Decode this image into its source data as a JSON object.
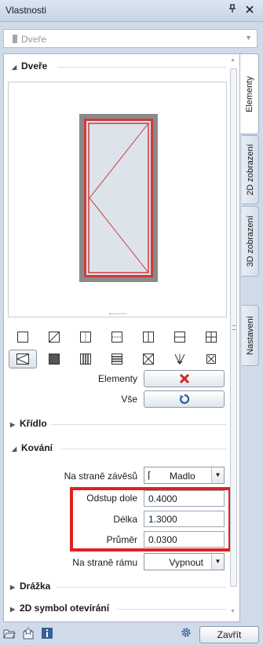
{
  "window": {
    "title": "Vlastnosti",
    "pin_icon": "pin-icon",
    "close_icon": "close-icon"
  },
  "element_selector": {
    "value": "Dveře"
  },
  "sections": {
    "dvere": {
      "label": "Dveře",
      "expanded": true
    },
    "kridlo": {
      "label": "Křídlo",
      "expanded": false
    },
    "kovani": {
      "label": "Kování",
      "expanded": true
    },
    "drazka": {
      "label": "Drážka",
      "expanded": false
    },
    "symbol2d": {
      "label": "2D symbol otevírání",
      "expanded": false
    }
  },
  "element_icons": [
    "frame-icon",
    "diagonal-frame-icon",
    "left-divider-icon",
    "top-divider-icon",
    "vertical-split-icon",
    "horizontal-split-icon",
    "cross-split-icon",
    "swing-left-icon",
    "solid-panel-icon",
    "vertical-bars-icon",
    "horizontal-bars-icon",
    "x-cross-icon",
    "arrow-down-cross-icon",
    "small-x-icon"
  ],
  "selected_icon": "swing-left-icon",
  "actions": {
    "elementy_label": "Elementy",
    "vse_label": "Vše",
    "delete_icon": "red-x-icon",
    "reset_icon": "refresh-icon"
  },
  "hardware": {
    "hinge_side_label": "Na straně závěsů",
    "hinge_side_value": "Madlo",
    "offset_label": "Odstup dole",
    "offset_value": "0.4000",
    "length_label": "Délka",
    "length_value": "1.3000",
    "diameter_label": "Průměr",
    "diameter_value": "0.0300",
    "frame_side_label": "Na straně rámu",
    "frame_side_value": "Vypnout"
  },
  "tabs": [
    {
      "label": "Elementy",
      "active": true
    },
    {
      "label": "2D zobrazení",
      "active": false
    },
    {
      "label": "3D zobrazení",
      "active": false
    },
    {
      "label": "Nastavení",
      "active": false
    }
  ],
  "footer": {
    "close_label": "Zavřít"
  },
  "colors": {
    "highlight": "#e02020",
    "door_frame": "#d03a3a",
    "door_glass": "#dde3ea"
  }
}
